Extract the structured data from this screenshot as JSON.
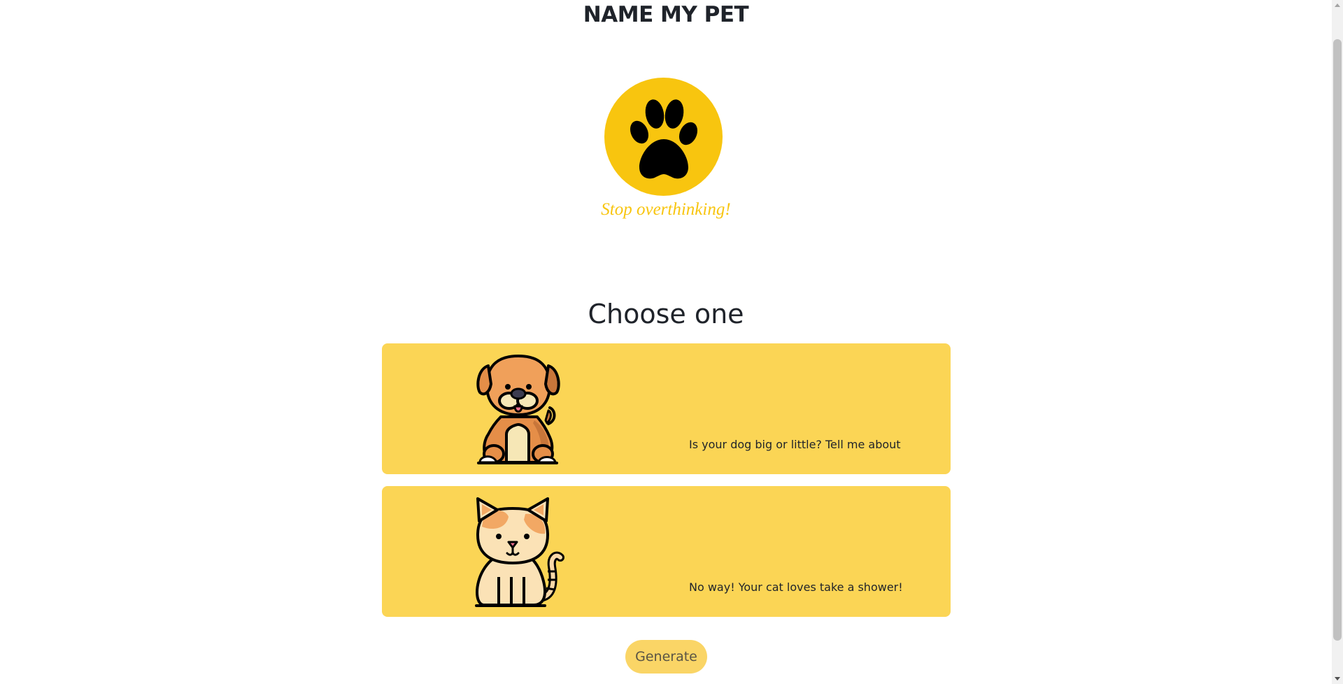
{
  "header": {
    "title": "NAME MY PET",
    "tagline": "Stop overthinking!"
  },
  "logo": {
    "icon": "paw-icon",
    "color": "#f8c50f"
  },
  "main": {
    "heading": "Choose one",
    "options": [
      {
        "id": "dog",
        "icon": "dog-illustration",
        "text": "Is your dog big or little? Tell me about"
      },
      {
        "id": "cat",
        "icon": "cat-illustration",
        "text": "No way! Your cat loves take a shower!"
      }
    ],
    "generate_label": "Generate"
  },
  "colors": {
    "accent": "#f8c50f",
    "card": "#fbd555",
    "button": "#fad566",
    "text": "#1f232a"
  }
}
